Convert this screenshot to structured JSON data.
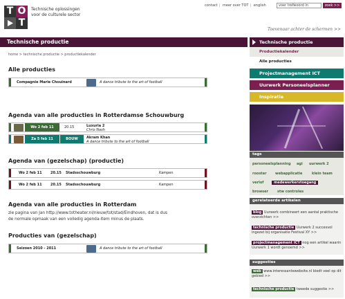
{
  "header": {
    "logo": [
      "T",
      "O",
      "",
      "T"
    ],
    "tagline_1": "Technische oplossingen",
    "tagline_2": "voor de culturele sector",
    "links": [
      "contact",
      "meer over TOT",
      "english"
    ],
    "search_placeholder": "voer trefwoord in",
    "search_button": "zoek >>",
    "slogan": "Toevenaar achter de schermen >>"
  },
  "page": {
    "title": "Technische productie",
    "breadcrumb": "home  >  technische productie  >  productiekalender"
  },
  "sections": {
    "alle_producties": {
      "heading": "Alle producties",
      "rows": [
        {
          "company": "Compagnie Marie Chouinard",
          "desc": "A dance tribute to the art of football"
        }
      ]
    },
    "rotterdam_schouwburg": {
      "heading": "Agenda van alle producties in Rotterdamse Schouwburg",
      "rows": [
        {
          "date": "Wo 2 feb 11",
          "time": "20.15",
          "title": "Luxuria 2",
          "sub": "Chris Nash"
        },
        {
          "date": "Za 5 feb 11",
          "label": "BOUW",
          "title": "Akram Khan",
          "sub": "A dance tribute to the art of football"
        }
      ]
    },
    "gezelschap_productie": {
      "heading": "Agenda van (gezelschap) (productie)",
      "rows": [
        {
          "date": "Wo 2 feb 11",
          "time": "20.15",
          "venue": "Stadsschouwburg",
          "room": "Kampen"
        },
        {
          "date": "Wo 2 feb 11",
          "time": "20.15",
          "venue": "Stadsschouwburg",
          "room": "Kampen"
        }
      ]
    },
    "rotterdam": {
      "heading": "Agenda van alle producties in Rotterdam",
      "text_1": "zie pagina van Jan http://www.totheater.nl/nieuw/tot/stad/Eindhoven, dat is dus",
      "text_2": "de normale opmaak van een volledig agenda-item minus de plaats."
    },
    "producties_gezelschap": {
      "heading": "Producties van (gezelschap)",
      "rows": [
        {
          "season": "Seizoen 2010 - 2011",
          "desc": "A dance tribute to the art of football"
        }
      ]
    }
  },
  "sidebar": {
    "active": "Technische productie",
    "sub_items": [
      "Productiekalender",
      "Alle producties"
    ],
    "blocks": [
      {
        "label": "Projectmanagement ICT",
        "color": "#0f7a6f"
      },
      {
        "label": "Uurwerk Personeelsplanner",
        "color": "#7a1f4f"
      },
      {
        "label": "Inspiratie",
        "color": "#d6b82a"
      }
    ],
    "tags_heading": "tags",
    "tags": [
      "personeelsplanning",
      "agi",
      "uurwerk 2",
      "rooster",
      "webapplicatie",
      "klein team",
      "verlof",
      "medewerkerstoegang",
      "browser",
      "stw controles"
    ],
    "articles_heading": "gerelateerde artikelen",
    "articles": [
      {
        "chip": "blog",
        "text": "Uurwerk combineert een aantal praktische overzichten >>"
      },
      {
        "chip": "technische productie",
        "text": "Uurwerk 2 succesvol ingezet bij organisatie Festival XY >>"
      },
      {
        "chip": "projectmanagement ICT",
        "text": "nog een artikel waarin Uurwerk 1 wordt genoemd >>"
      }
    ],
    "suggest_heading": "suggesties",
    "suggestions": [
      {
        "chip": "web",
        "text": "www.interessantewebsite.nl biedt veel op dit gebied >>"
      },
      {
        "chip": "technische productie",
        "text": "tweede suggestie >>"
      }
    ]
  },
  "colors": {
    "plum": "#4a1436",
    "green": "#3d6b38",
    "darkred": "#6b1424",
    "teal": "#0f7a6f"
  }
}
